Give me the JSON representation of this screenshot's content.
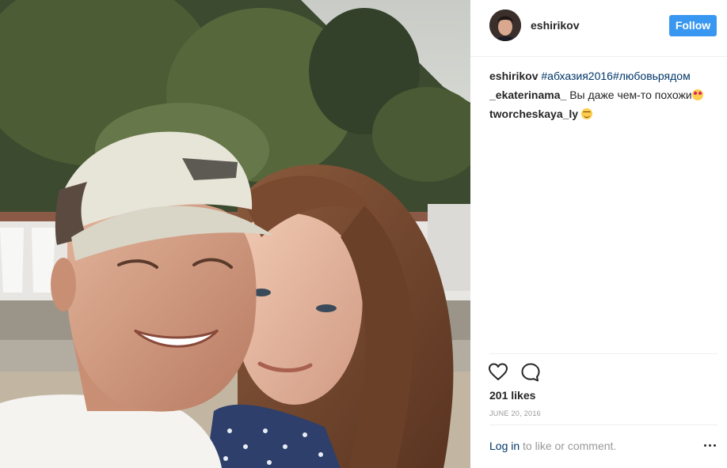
{
  "post": {
    "author": "eshirikov",
    "follow_label": "Follow",
    "caption": {
      "user": "eshirikov",
      "hashtags": "#абхазия2016#любовьрядом"
    },
    "comments": [
      {
        "user": "_ekaterinama_",
        "text": "Вы даже чем-то похожи",
        "emoji": "heart-eyes-emoji"
      },
      {
        "user": "tworcheskaya_ly",
        "text": "",
        "emoji": "blush-emoji"
      }
    ],
    "likes": "201 likes",
    "date": "JUNE 20, 2016",
    "login_link": "Log in",
    "login_rest": " to like or comment."
  },
  "icons": {
    "like": "heart-outline-icon",
    "comment": "speech-bubble-icon",
    "more": "more-options-icon"
  },
  "colors": {
    "follow_button": "#3897f0",
    "link": "#003569",
    "muted": "#999999"
  }
}
